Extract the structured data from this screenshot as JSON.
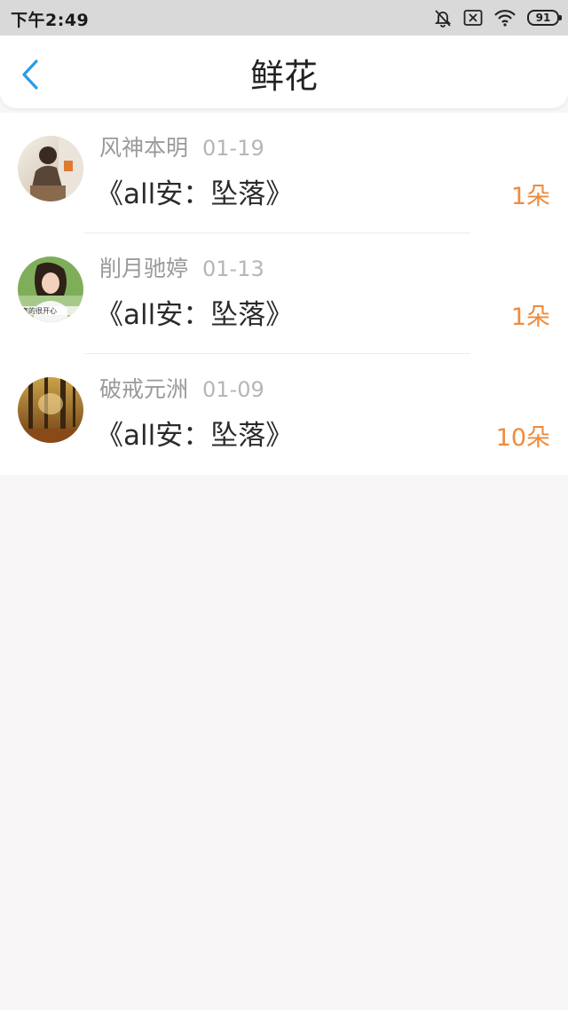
{
  "status_bar": {
    "time": "下午2:49",
    "battery": "91",
    "icons": [
      "bell-off-icon",
      "sim-x-icon",
      "wifi-icon",
      "battery-icon"
    ]
  },
  "header": {
    "title": "鲜花",
    "back_icon": "chevron-left-icon",
    "accent_color": "#2a9be8"
  },
  "gifts": [
    {
      "user": "风神本明",
      "date": "01-19",
      "book": "《all安：坠落》",
      "count": "1朵",
      "avatar_icon": "avatar-photo"
    },
    {
      "user": "削月驰婷",
      "date": "01-13",
      "book": "《all安：坠落》",
      "count": "1朵",
      "avatar_icon": "avatar-photo",
      "avatar_caption": "真的很开心"
    },
    {
      "user": "破戒元洲",
      "date": "01-09",
      "book": "《all安：坠落》",
      "count": "10朵",
      "avatar_icon": "avatar-photo"
    }
  ],
  "colors": {
    "count": "#f08a3c",
    "background": "#f8f6f6",
    "status_bar": "#d9d9d9"
  }
}
